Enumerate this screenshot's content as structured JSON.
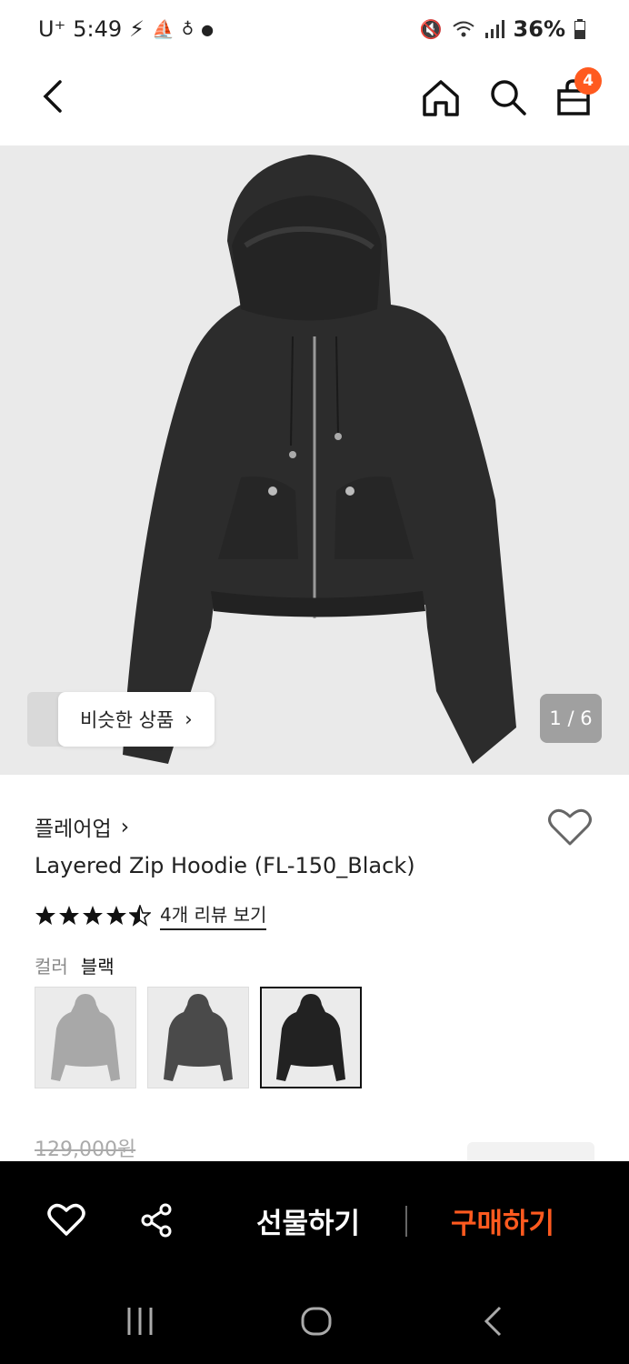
{
  "status": {
    "carrier": "U⁺",
    "time": "5:49",
    "battery": "36%"
  },
  "cart": {
    "count": "4"
  },
  "gallery": {
    "similar_label": "비슷한 상품",
    "pager": "1 / 6"
  },
  "product": {
    "brand": "플레어업",
    "title": "Layered Zip Hoodie (FL-150_Black)",
    "rating": 4.5,
    "review_link": "4개 리뷰 보기",
    "color_label": "컬러",
    "color_value": "블랙",
    "original_price": "129,000원"
  },
  "bottom": {
    "gift_label": "선물하기",
    "buy_label": "구매하기"
  },
  "colors": {
    "accent": "#ff5a1f",
    "bar": "#000000"
  }
}
